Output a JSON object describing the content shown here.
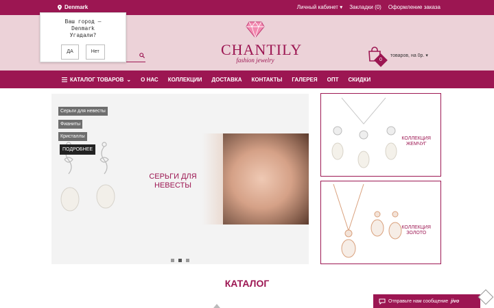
{
  "topbar": {
    "city": "Denmark",
    "links": [
      "Личный кабинет",
      "Закладки (0)",
      "Оформление заказа"
    ]
  },
  "popup": {
    "line1": "Ваш город —",
    "line2": "Denmark",
    "line3": "Угадали?",
    "yes": "ДА",
    "no": "Нет"
  },
  "logo": {
    "name": "CHANTILY",
    "tagline": "fashion jewelry"
  },
  "cart": {
    "count": "0",
    "text": "товаров, на 0р."
  },
  "nav": {
    "catalog": "КАТАЛОГ ТОВАРОВ",
    "items": [
      "О НАС",
      "КОЛЛЕКЦИИ",
      "ДОСТАВКА",
      "КОНТАКТЫ",
      "ГАЛЕРЕЯ",
      "ОПТ",
      "СКИДКИ"
    ]
  },
  "slider": {
    "tags": [
      "Серьги для невесты",
      "Фианиты",
      "Кристаллы"
    ],
    "more": "ПОДРОБНЕЕ",
    "title": "СЕРЬГИ ДЛЯ НЕВЕСТЫ",
    "dots": 3,
    "active_dot": 1
  },
  "banners": [
    {
      "line1": "КОЛЛЕКЦИЯ",
      "line2": "ЖЕМЧУГ"
    },
    {
      "line1": "КОЛЛЕКЦИЯ",
      "line2": "ЗОЛОТО"
    }
  ],
  "catalog_title": "КАТАЛОГ",
  "chat": {
    "text": "Отправьте нам сообщение",
    "brand": "jivo"
  },
  "colors": {
    "brand": "#9c1652",
    "header_bg": "#ecd2d8"
  }
}
